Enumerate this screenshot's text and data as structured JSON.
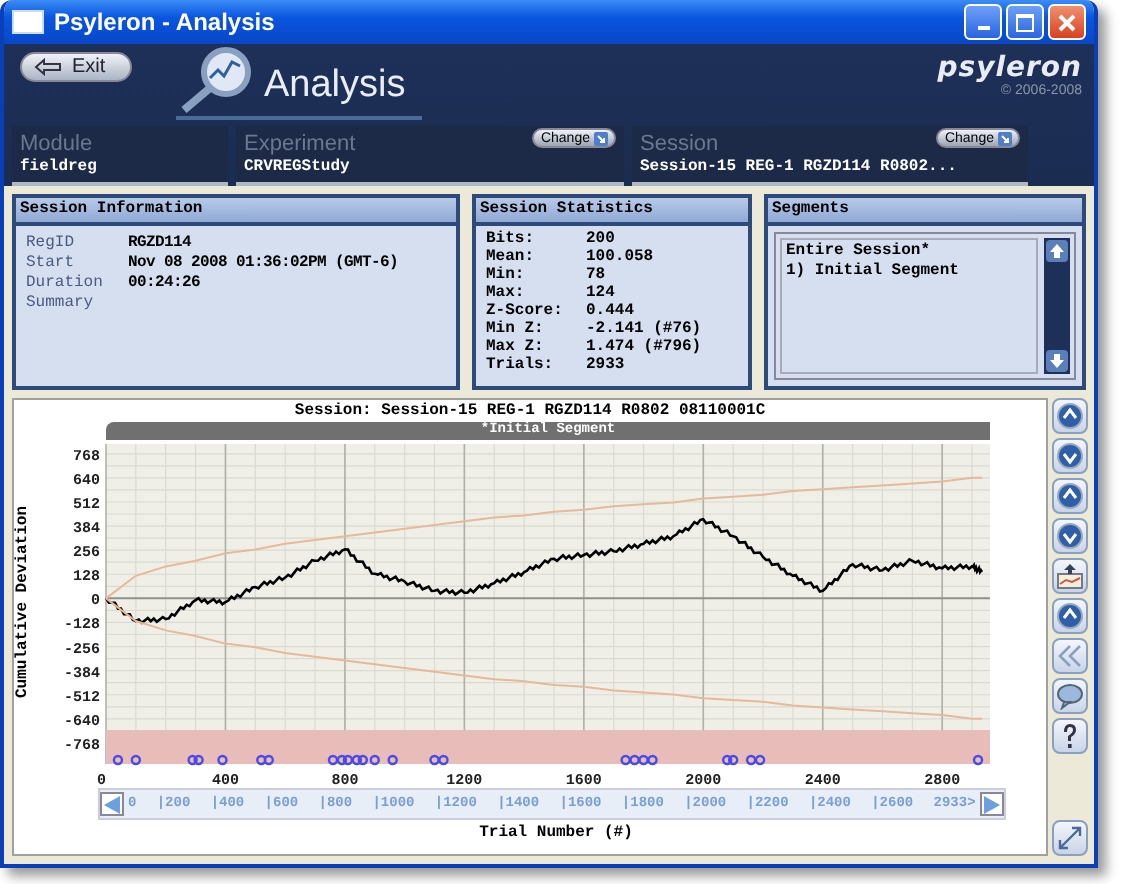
{
  "window": {
    "title": "Psyleron - Analysis"
  },
  "header": {
    "exit_button": "Exit",
    "section_title": "Analysis",
    "brand": "psyleron",
    "copyright": "© 2006-2008"
  },
  "selectors": [
    {
      "label": "Module",
      "value": "fieldreg"
    },
    {
      "label": "Experiment",
      "value": "CRVREGStudy",
      "button": "Change"
    },
    {
      "label": "Session",
      "value": "Session-15 REG-1 RGZD114 R0802...",
      "button": "Change"
    }
  ],
  "session_information": {
    "title": "Session Information",
    "rows": [
      {
        "label": "RegID",
        "value": "RGZD114"
      },
      {
        "label": "Start",
        "value": "Nov 08 2008 01:36:02PM (GMT-6)"
      },
      {
        "label": "Duration",
        "value": "00:24:26"
      },
      {
        "label": "Summary"
      }
    ]
  },
  "session_statistics": {
    "title": "Session Statistics",
    "rows": [
      {
        "label": "Bits:",
        "value": "200"
      },
      {
        "label": "Mean:",
        "value": "100.058"
      },
      {
        "label": "Min:",
        "value": "78"
      },
      {
        "label": "Max:",
        "value": "124"
      },
      {
        "label": "Z-Score:",
        "value": "0.444"
      },
      {
        "label": "Min Z:",
        "value": "-2.141 (#76)"
      },
      {
        "label": "Max Z:",
        "value": "1.474 (#796)"
      },
      {
        "label": "Trials:",
        "value": "2933"
      }
    ]
  },
  "segments": {
    "title": "Segments",
    "items": [
      "Entire Session*",
      "1) Initial Segment"
    ]
  },
  "analysis_chart": {
    "segment_label": "*Initial Segment",
    "ruler": [
      "0",
      "|200",
      "|400",
      "|600",
      "|800",
      "|1000",
      "|1200",
      "|1400",
      "|1600",
      "|1800",
      "|2000",
      "|2200",
      "|2400",
      "|2600",
      "2933>"
    ],
    "chart_data": {
      "type": "line",
      "title": "Session: Session-15 REG-1 RGZD114 R0802 08110001C",
      "xlabel": "Trial Number (#)",
      "ylabel": "Cumulative Deviation",
      "x": [
        0,
        100,
        200,
        300,
        400,
        500,
        600,
        700,
        800,
        900,
        1000,
        1100,
        1200,
        1300,
        1400,
        1500,
        1600,
        1700,
        1800,
        1900,
        2000,
        2100,
        2200,
        2300,
        2400,
        2500,
        2600,
        2700,
        2800,
        2900,
        2933
      ],
      "series": [
        {
          "color": "#000000",
          "values": [
            0,
            -120,
            -110,
            -10,
            -20,
            60,
            110,
            200,
            260,
            130,
            90,
            40,
            30,
            80,
            140,
            210,
            230,
            250,
            290,
            330,
            420,
            330,
            220,
            120,
            40,
            180,
            150,
            200,
            160,
            170,
            140
          ]
        },
        {
          "color": "#e8b898",
          "values": [
            0,
            120,
            170,
            200,
            240,
            260,
            290,
            310,
            330,
            350,
            370,
            390,
            410,
            430,
            440,
            460,
            470,
            490,
            500,
            510,
            530,
            540,
            550,
            570,
            580,
            590,
            600,
            610,
            620,
            640,
            640
          ]
        },
        {
          "color": "#e8b898",
          "values": [
            0,
            -120,
            -170,
            -200,
            -240,
            -260,
            -290,
            -310,
            -330,
            -350,
            -370,
            -390,
            -410,
            -430,
            -440,
            -460,
            -470,
            -490,
            -500,
            -510,
            -530,
            -540,
            -550,
            -570,
            -580,
            -590,
            -600,
            -610,
            -620,
            -640,
            -640
          ]
        }
      ],
      "grid": true,
      "xlim": [
        0,
        2960
      ],
      "ylim": [
        -880,
        820
      ],
      "xticks": [
        0,
        400,
        800,
        1200,
        1600,
        2000,
        2400,
        2800
      ],
      "yticks": [
        768,
        640,
        512,
        384,
        256,
        128,
        0,
        -128,
        -256,
        -384,
        -512,
        -640,
        -768
      ]
    }
  }
}
